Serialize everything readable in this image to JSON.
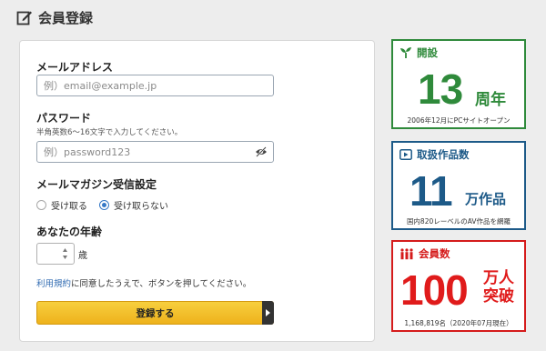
{
  "header": {
    "title": "会員登録",
    "icon": "edit-note-icon"
  },
  "form": {
    "email": {
      "label": "メールアドレス",
      "placeholder": "例）email@example.jp"
    },
    "password": {
      "label": "パスワード",
      "hint": "半角英数6〜16文字で入力してください。",
      "placeholder": "例）password123"
    },
    "newsletter": {
      "label": "メールマガジン受信設定",
      "options": [
        "受け取る",
        "受け取らない"
      ],
      "selected": "受け取らない"
    },
    "age": {
      "label": "あなたの年齢",
      "unit": "歳"
    },
    "terms": {
      "link": "利用規約",
      "text": "に同意したうえで、ボタンを押してください。"
    },
    "submit_label": "登録する"
  },
  "stats": [
    {
      "title": "開設",
      "big": "13",
      "unit": "周年",
      "foot": "2006年12月にPCサイトオープン",
      "color": "#2f8a3b",
      "icon": "sprout-icon"
    },
    {
      "title": "取扱作品数",
      "big": "11",
      "unit": "万作品",
      "foot": "国内820レーベルのAV作品を網羅",
      "color": "#1d5a88",
      "icon": "play-icon"
    },
    {
      "title": "会員数",
      "big": "100",
      "unit": "万人突破",
      "unit_line1": "万人",
      "unit_line2": "突破",
      "foot": "1,168,819名（2020年07月現在）",
      "color": "#d51b1b",
      "icon": "people-icon"
    }
  ]
}
